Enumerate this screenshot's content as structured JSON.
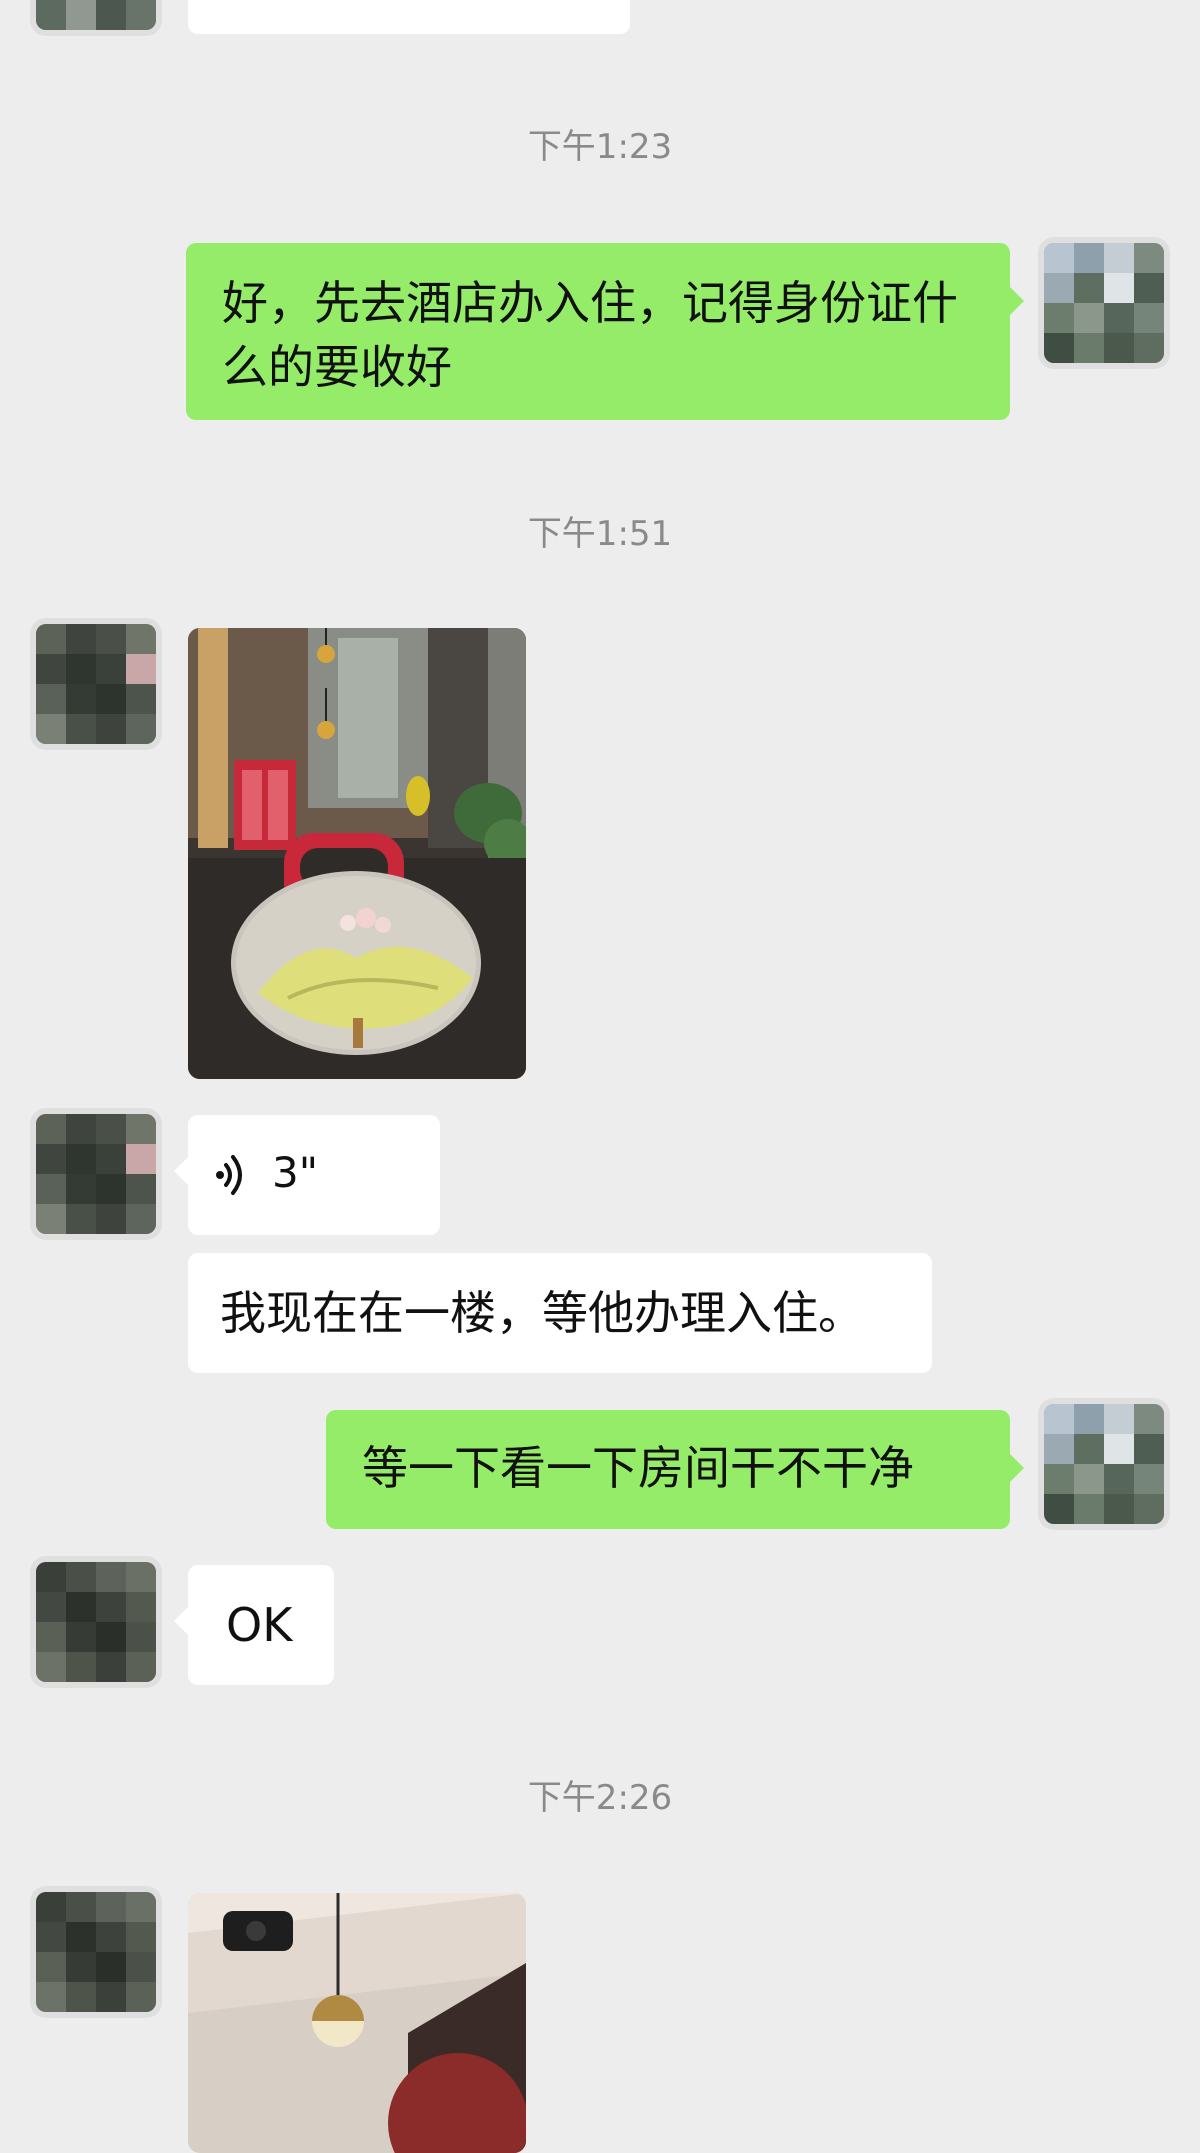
{
  "timestamps": [
    "下午1:23",
    "下午1:51",
    "下午2:26"
  ],
  "messages": [
    {
      "side": "right",
      "type": "text",
      "text": "好，先去酒店办入住，记得身份证什么的要收好"
    },
    {
      "side": "left",
      "type": "image",
      "alt": "hotel-lobby-photo"
    },
    {
      "side": "left",
      "type": "voice",
      "duration": "3\""
    },
    {
      "side": "left",
      "type": "text",
      "text": "我现在在一楼，等他办理入住。"
    },
    {
      "side": "right",
      "type": "text",
      "text": "等一下看一下房间干不干净"
    },
    {
      "side": "left",
      "type": "text",
      "text": "OK"
    },
    {
      "side": "left",
      "type": "image",
      "alt": "hotel-room-photo"
    }
  ],
  "colors": {
    "background": "#ededed",
    "bubble_self": "#95ec69",
    "bubble_other": "#ffffff",
    "timestamp": "#8a8a8a"
  },
  "icons": {
    "voice": "voice-wave-icon"
  }
}
